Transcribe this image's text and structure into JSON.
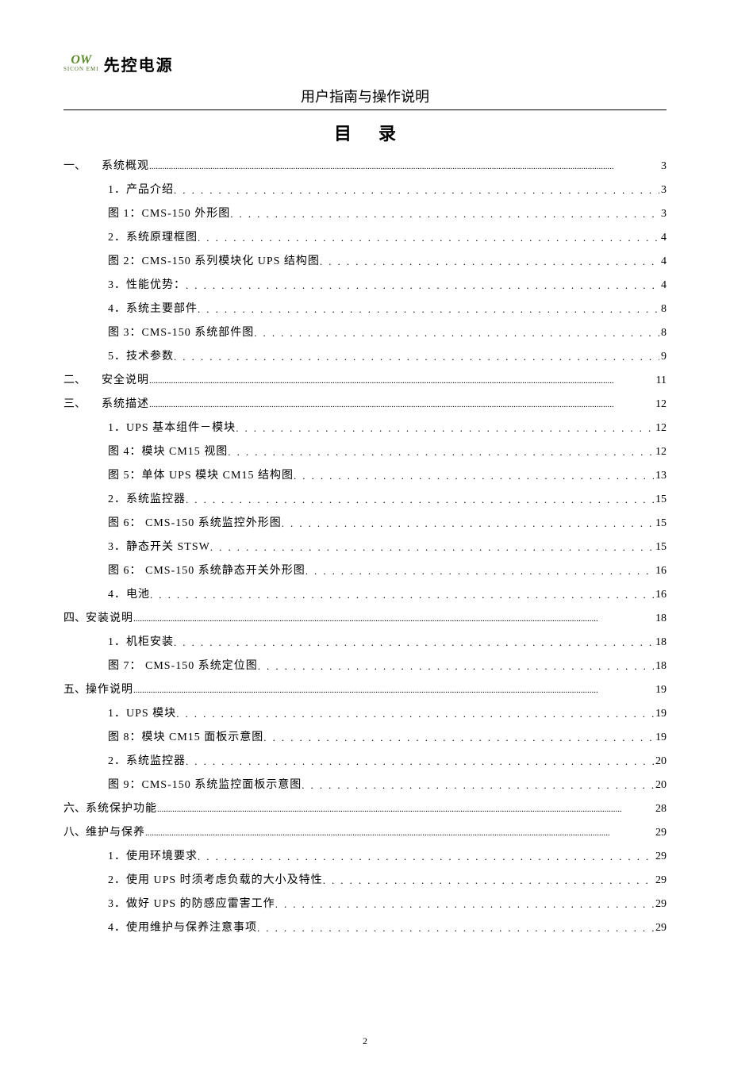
{
  "header": {
    "logo_top": "OW",
    "logo_bottom": "SICON EMI",
    "brand": "先控电源",
    "subtitle": "用户指南与操作说明"
  },
  "title": "目 录",
  "toc": [
    {
      "level": 1,
      "num": "一、",
      "label": "系统概观",
      "page": "3",
      "dots": "dense"
    },
    {
      "level": 2,
      "num": "",
      "label": "1．产品介绍",
      "page": "3",
      "dots": "sparse"
    },
    {
      "level": 2,
      "num": "",
      "label": "图 1：CMS-150 外形图",
      "page": "3",
      "dots": "sparse"
    },
    {
      "level": 2,
      "num": "",
      "label": "2．系统原理框图",
      "page": "4",
      "dots": "sparse"
    },
    {
      "level": 2,
      "num": "",
      "label": "图 2：CMS-150 系列模块化 UPS 结构图",
      "page": "4",
      "dots": "sparse"
    },
    {
      "level": 2,
      "num": "",
      "label": "3．性能优势：",
      "page": "4",
      "dots": "sparse"
    },
    {
      "level": 2,
      "num": "",
      "label": "4．系统主要部件",
      "page": "8",
      "dots": "sparse"
    },
    {
      "level": 2,
      "num": "",
      "label": "图 3：CMS-150 系统部件图",
      "page": "8",
      "dots": "sparse"
    },
    {
      "level": 2,
      "num": "",
      "label": "5．技术参数",
      "page": "9",
      "dots": "sparse"
    },
    {
      "level": 1,
      "num": "二、",
      "label": "安全说明",
      "page": "11",
      "dots": "dense"
    },
    {
      "level": 1,
      "num": "三、",
      "label": "系统描述",
      "page": "12",
      "dots": "dense"
    },
    {
      "level": 2,
      "num": "",
      "label": "1．UPS 基本组件－模块",
      "page": "12",
      "dots": "sparse"
    },
    {
      "level": 2,
      "num": "",
      "label": "图 4：模块 CM15 视图",
      "page": "12",
      "dots": "sparse"
    },
    {
      "level": 2,
      "num": "",
      "label": "图 5：单体 UPS 模块 CM15 结构图",
      "page": "13",
      "dots": "sparse"
    },
    {
      "level": 2,
      "num": "",
      "label": "2．系统监控器",
      "page": "15",
      "dots": "sparse"
    },
    {
      "level": 2,
      "num": "",
      "label": "图 6： CMS-150 系统监控外形图",
      "page": "15",
      "dots": "sparse"
    },
    {
      "level": 2,
      "num": "",
      "label": "3．静态开关 STSW",
      "page": "15",
      "dots": "sparse"
    },
    {
      "level": 2,
      "num": "",
      "label": "图 6： CMS-150 系统静态开关外形图",
      "page": "16",
      "dots": "sparse"
    },
    {
      "level": 2,
      "num": "",
      "label": "4．电池",
      "page": "16",
      "dots": "sparse"
    },
    {
      "level": 1,
      "num": "四、",
      "label": "安装说明",
      "page": "18",
      "dots": "dense",
      "noindent": true
    },
    {
      "level": 2,
      "num": "",
      "label": "1．机柜安装",
      "page": "18",
      "dots": "sparse"
    },
    {
      "level": 2,
      "num": "",
      "label": "图 7： CMS-150 系统定位图",
      "page": "18",
      "dots": "sparse"
    },
    {
      "level": 1,
      "num": "五、",
      "label": "操作说明",
      "page": "19",
      "dots": "dense",
      "noindent": true
    },
    {
      "level": 2,
      "num": "",
      "label": "1．UPS 模块",
      "page": "19",
      "dots": "sparse"
    },
    {
      "level": 2,
      "num": "",
      "label": "图 8：模块 CM15 面板示意图",
      "page": "19",
      "dots": "sparse"
    },
    {
      "level": 2,
      "num": "",
      "label": "2．系统监控器",
      "page": "20",
      "dots": "sparse"
    },
    {
      "level": 2,
      "num": "",
      "label": "图 9：CMS-150 系统监控面板示意图",
      "page": "20",
      "dots": "sparse"
    },
    {
      "level": 1,
      "num": "六、",
      "label": "系统保护功能",
      "page": "28",
      "dots": "dense",
      "noindent": true
    },
    {
      "level": 1,
      "num": "八、",
      "label": "维护与保养",
      "page": "29",
      "dots": "dense",
      "noindent": true
    },
    {
      "level": 2,
      "num": "",
      "label": "1．使用环境要求",
      "page": "29",
      "dots": "sparse"
    },
    {
      "level": 2,
      "num": "",
      "label": "2．使用 UPS 时须考虑负载的大小及特性",
      "page": "29",
      "dots": "sparse"
    },
    {
      "level": 2,
      "num": "",
      "label": "3．做好 UPS 的防感应雷害工作",
      "page": "29",
      "dots": "sparse"
    },
    {
      "level": 2,
      "num": "",
      "label": "4．使用维护与保养注意事项",
      "page": "29",
      "dots": "sparse"
    }
  ],
  "pagenum": "2"
}
